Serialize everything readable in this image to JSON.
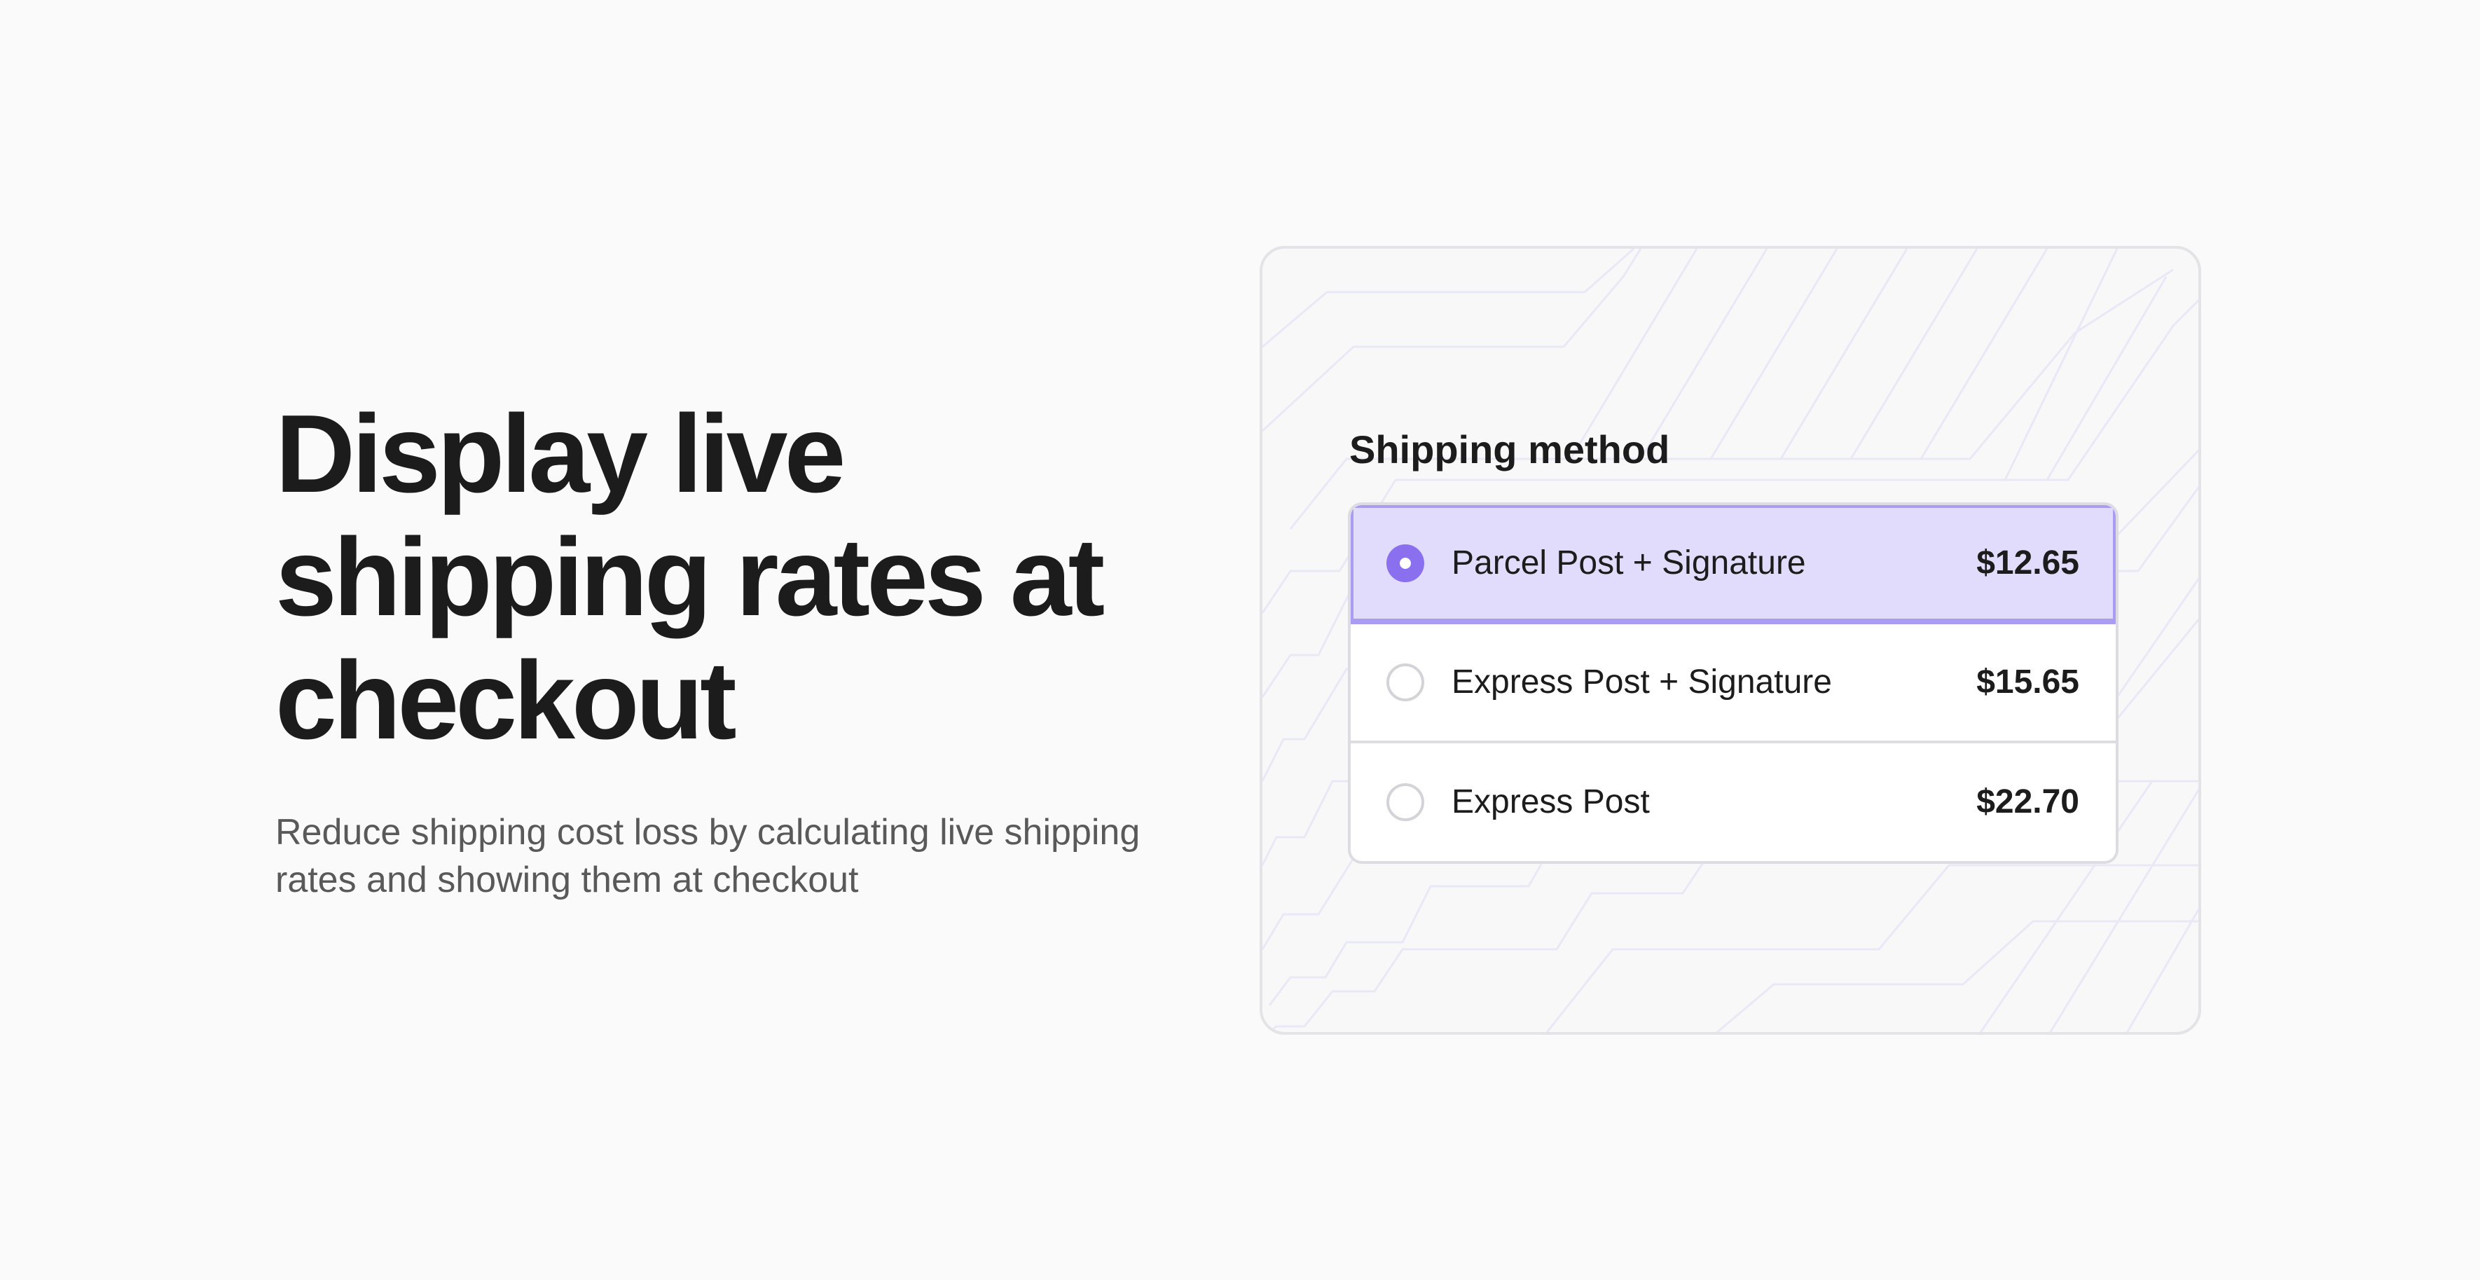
{
  "hero": {
    "headline": "Display live shipping rates at checkout",
    "subheadline": "Reduce shipping cost loss by calculating live shipping rates and showing them at checkout"
  },
  "shipping": {
    "title": "Shipping method",
    "options": [
      {
        "label": "Parcel Post + Signature",
        "price": "$12.65",
        "selected": true
      },
      {
        "label": "Express Post + Signature",
        "price": "$15.65",
        "selected": false
      },
      {
        "label": "Express Post",
        "price": "$22.70",
        "selected": false
      }
    ]
  },
  "colors": {
    "background": "#fafafa",
    "accent": "#8a70ef",
    "selected_row": "#e1dcfb",
    "selected_border": "#a99cf2",
    "heading_text": "#1c1c1c",
    "body_text": "#595959"
  }
}
